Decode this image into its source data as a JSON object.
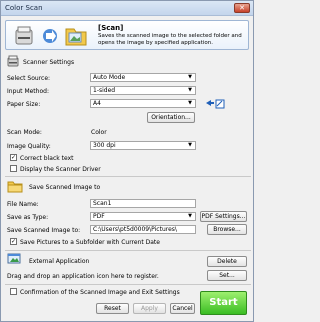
{
  "window": {
    "title": "Color Scan",
    "close_glyph": "✕"
  },
  "header": {
    "title": "[Scan]",
    "description": "Saves the scanned image to the selected folder and opens the image by specified application."
  },
  "scanner_settings": {
    "heading": "Scanner Settings",
    "select_source": {
      "label": "Select Source:",
      "value": "Auto Mode"
    },
    "input_method": {
      "label": "Input Method:",
      "value": "1-sided"
    },
    "paper_size": {
      "label": "Paper Size:",
      "value": "A4"
    },
    "orientation_button": "Orientation...",
    "scan_mode": {
      "label": "Scan Mode:",
      "value": "Color"
    },
    "image_quality": {
      "label": "Image Quality:",
      "value": "300 dpi"
    },
    "correct_black_text": {
      "label": "Correct black text",
      "checked": true
    },
    "display_driver": {
      "label": "Display the Scanner Driver",
      "checked": false
    }
  },
  "save_settings": {
    "heading": "Save Scanned Image to",
    "file_name": {
      "label": "File Name:",
      "value": "Scan1"
    },
    "save_as_type": {
      "label": "Save as Type:",
      "value": "PDF"
    },
    "pdf_settings_button": "PDF Settings...",
    "save_to": {
      "label": "Save Scanned Image to:",
      "value": "C:\\Users\\pt5d0009\\Pictures\\"
    },
    "browse_button": "Browse...",
    "subfolder": {
      "label": "Save Pictures to a Subfolder with Current Date",
      "checked": true
    }
  },
  "external_app": {
    "heading": "External Application",
    "delete_button": "Delete",
    "hint": "Drag and drop an application icon here to register.",
    "set_button": "Set..."
  },
  "footer": {
    "confirm": {
      "label": "Confirmation of the Scanned Image and Exit Settings",
      "checked": false
    },
    "reset_button": "Reset",
    "apply_button": "Apply",
    "cancel_button": "Cancel",
    "start_button": "Start"
  },
  "colors": {
    "start_green": "#3bbd23",
    "title_bar": "#c3d5ec",
    "accent_blue": "#1f5fb8"
  },
  "icons": [
    "printer-icon",
    "arrow-icon",
    "folder-icon",
    "scanner-icon",
    "orientation-icon",
    "application-icon"
  ]
}
